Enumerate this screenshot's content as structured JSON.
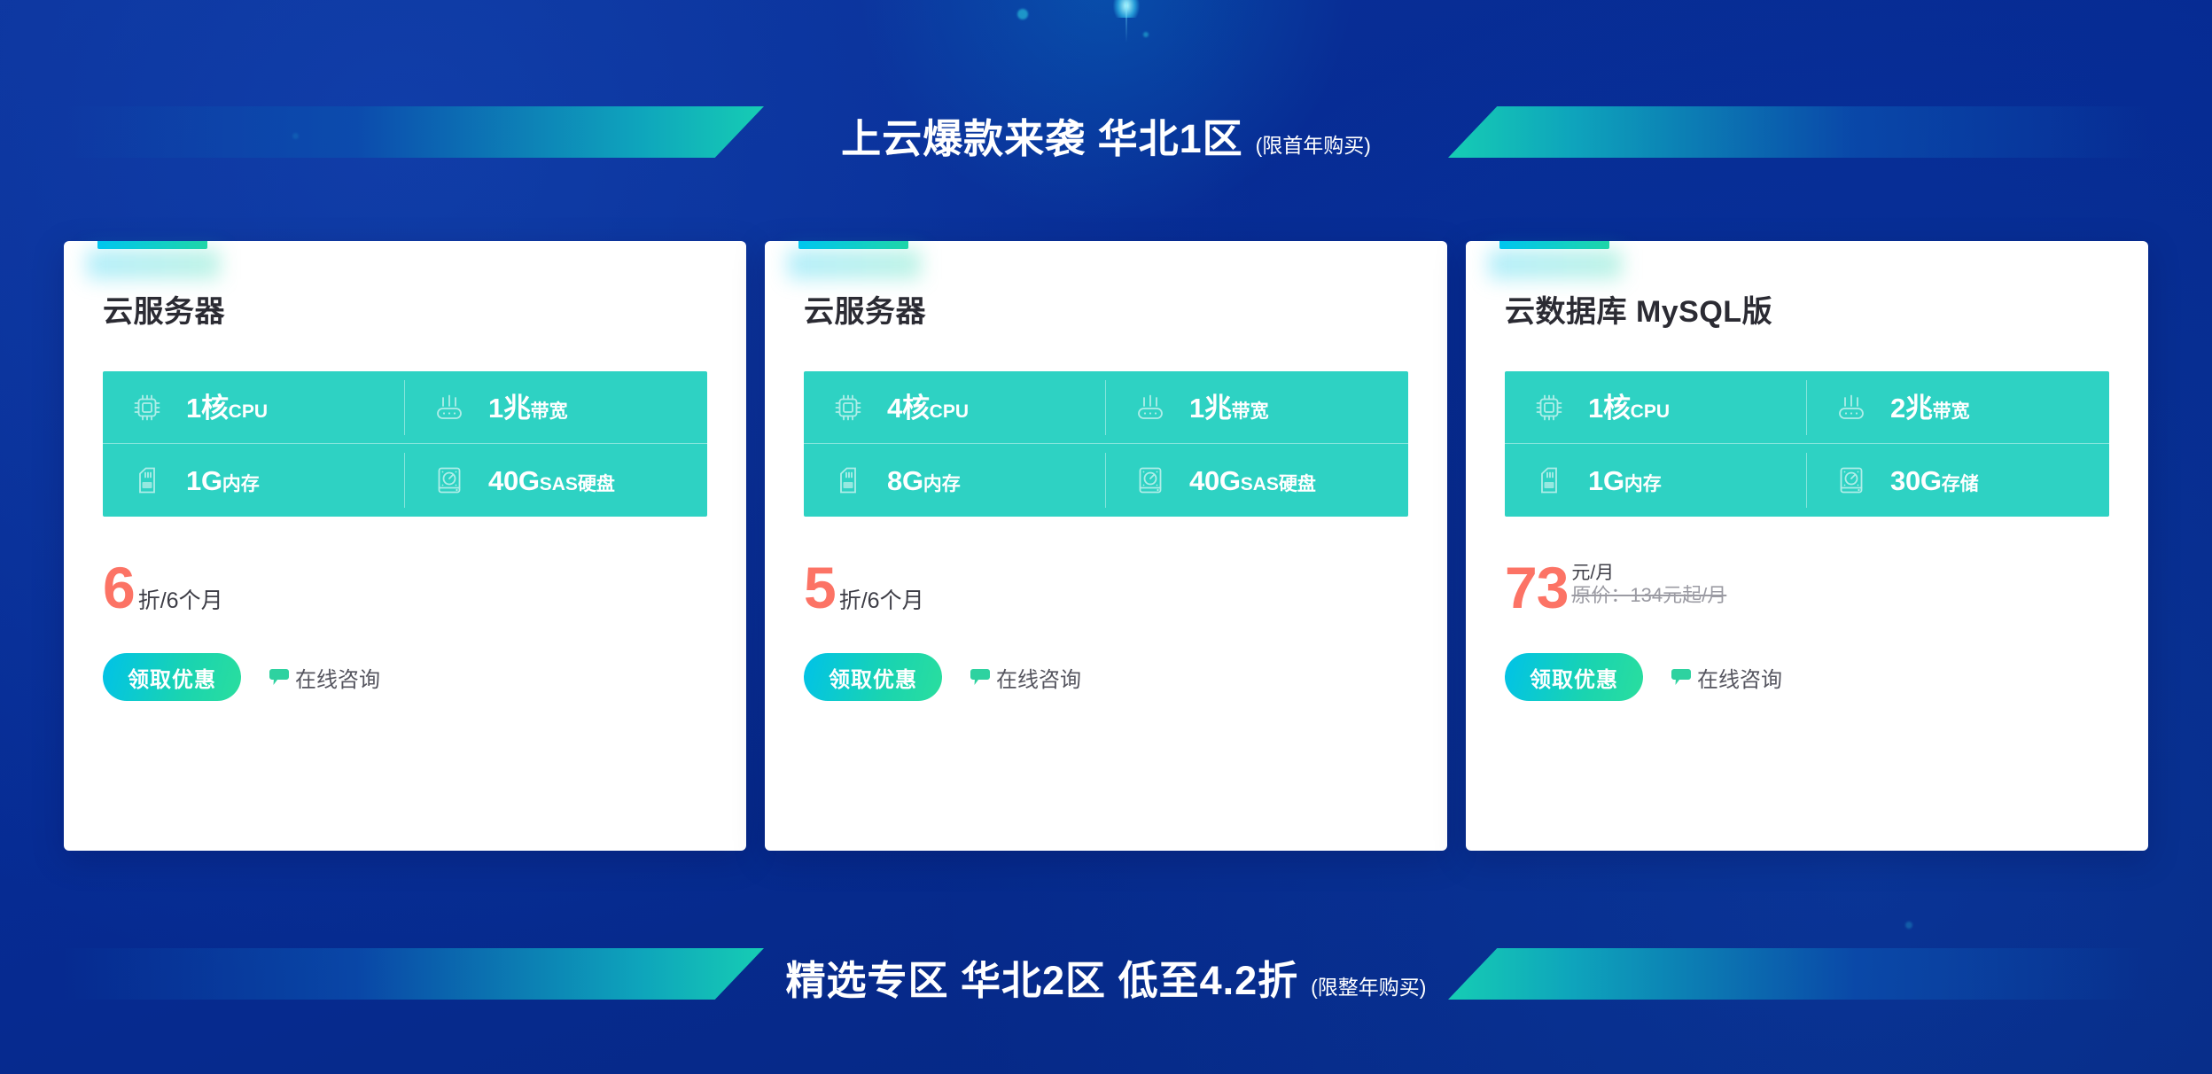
{
  "theme": {
    "background_blue": "#062b93",
    "accent_teal": "#2ed2c3",
    "accent_cyan": "#00c6f0",
    "price_red": "#fc7365",
    "card_white": "#ffffff"
  },
  "sections": {
    "top": {
      "title": "上云爆款来袭 华北1区",
      "note": "(限首年购买)"
    },
    "bottom": {
      "title": "精选专区 华北2区 低至4.2折",
      "note": "(限整年购买)"
    }
  },
  "cards": [
    {
      "title": "云服务器",
      "specs": [
        {
          "icon": "cpu-icon",
          "value": "1核",
          "unit": "CPU"
        },
        {
          "icon": "bandwidth-icon",
          "value": "1兆",
          "unit": "带宽"
        },
        {
          "icon": "memory-icon",
          "value": "1G",
          "unit": "内存"
        },
        {
          "icon": "disk-icon",
          "value": "40G",
          "unit": "SAS硬盘"
        }
      ],
      "price": {
        "number": "6",
        "suffix": "折/6个月",
        "original": ""
      },
      "cta_label": "领取优惠",
      "consult_label": "在线咨询"
    },
    {
      "title": "云服务器",
      "specs": [
        {
          "icon": "cpu-icon",
          "value": "4核",
          "unit": "CPU"
        },
        {
          "icon": "bandwidth-icon",
          "value": "1兆",
          "unit": "带宽"
        },
        {
          "icon": "memory-icon",
          "value": "8G",
          "unit": "内存"
        },
        {
          "icon": "disk-icon",
          "value": "40G",
          "unit": "SAS硬盘"
        }
      ],
      "price": {
        "number": "5",
        "suffix": "折/6个月",
        "original": ""
      },
      "cta_label": "领取优惠",
      "consult_label": "在线咨询"
    },
    {
      "title": "云数据库 MySQL版",
      "specs": [
        {
          "icon": "cpu-icon",
          "value": "1核",
          "unit": "CPU"
        },
        {
          "icon": "bandwidth-icon",
          "value": "2兆",
          "unit": "带宽"
        },
        {
          "icon": "memory-icon",
          "value": "1G",
          "unit": "内存"
        },
        {
          "icon": "disk-icon",
          "value": "30G",
          "unit": "存储"
        }
      ],
      "price": {
        "number": "73",
        "suffix": "元/月",
        "original": "原价：134元起/月"
      },
      "cta_label": "领取优惠",
      "consult_label": "在线咨询"
    }
  ]
}
